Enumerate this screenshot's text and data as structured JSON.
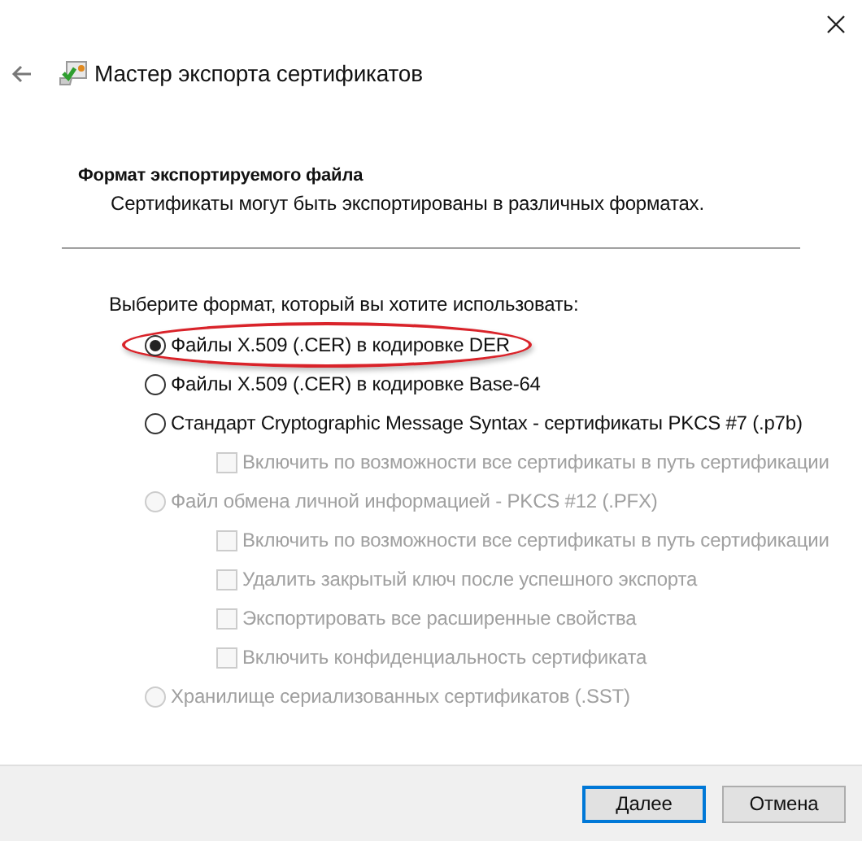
{
  "window": {
    "title": "Мастер экспорта сертификатов"
  },
  "header": {
    "title": "Формат экспортируемого файла",
    "subtitle": "Сертификаты могут быть экспортированы в различных форматах."
  },
  "prompt": "Выберите формат, который вы хотите использовать:",
  "options": [
    {
      "kind": "radio",
      "label": "Файлы X.509 (.CER) в кодировке DER",
      "selected": true,
      "disabled": false,
      "highlighted": true
    },
    {
      "kind": "radio",
      "label": "Файлы X.509 (.CER) в кодировке Base-64",
      "selected": false,
      "disabled": false,
      "highlighted": false
    },
    {
      "kind": "radio",
      "label": "Стандарт Cryptographic Message Syntax - сертификаты PKCS #7 (.p7b)",
      "selected": false,
      "disabled": false,
      "highlighted": false,
      "children": [
        {
          "kind": "checkbox",
          "label": "Включить по возможности все сертификаты в путь сертификации",
          "checked": false,
          "disabled": true
        }
      ]
    },
    {
      "kind": "radio",
      "label": "Файл обмена личной информацией - PKCS #12 (.PFX)",
      "selected": false,
      "disabled": true,
      "highlighted": false,
      "children": [
        {
          "kind": "checkbox",
          "label": "Включить по возможности все сертификаты в путь сертификации",
          "checked": false,
          "disabled": true
        },
        {
          "kind": "checkbox",
          "label": "Удалить закрытый ключ после успешного экспорта",
          "checked": false,
          "disabled": true
        },
        {
          "kind": "checkbox",
          "label": "Экспортировать все расширенные свойства",
          "checked": false,
          "disabled": true
        },
        {
          "kind": "checkbox",
          "label": "Включить конфиденциальность сертификата",
          "checked": false,
          "disabled": true
        }
      ]
    },
    {
      "kind": "radio",
      "label": "Хранилище сериализованных сертификатов (.SST)",
      "selected": false,
      "disabled": true,
      "highlighted": false
    }
  ],
  "buttons": [
    {
      "label": "Далее",
      "default": true
    },
    {
      "label": "Отмена",
      "default": false
    }
  ]
}
